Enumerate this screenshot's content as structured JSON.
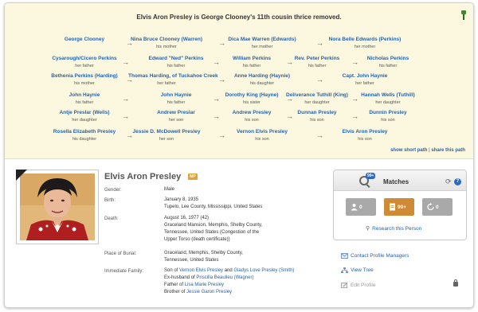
{
  "path": {
    "title": "Elvis Aron Presley is George Clooney's 11th cousin thrice removed.",
    "rows": [
      [
        {
          "name": "George Clooney",
          "rel": ""
        },
        {
          "name": "Nina Bruce Clooney (Warren)",
          "rel": "his mother"
        },
        {
          "name": "Dica Mae Warren (Edwards)",
          "rel": "her mother"
        },
        {
          "name": "Nora Belle Edwards (Perkins)",
          "rel": "her mother"
        }
      ],
      [
        {
          "name": "Cysarough/Cicero Perkins",
          "rel": "her father"
        },
        {
          "name": "Edward \"Ned\" Perkins",
          "rel": "his father"
        },
        {
          "name": "William Perkins",
          "rel": "his father"
        },
        {
          "name": "Rev. Peter Perkins",
          "rel": "his father"
        },
        {
          "name": "Nicholas Perkins",
          "rel": "his father"
        }
      ],
      [
        {
          "name": "Bethenia Perkins (Harding)",
          "rel": "his mother"
        },
        {
          "name": "Thomas Harding, of Tuckahoe Creek",
          "rel": "her father"
        },
        {
          "name": "Anne Harding (Haynie)",
          "rel": "his daughter"
        },
        {
          "name": "Capt. John Haynie",
          "rel": "her father"
        }
      ],
      [
        {
          "name": "John Haynie",
          "rel": "his father"
        },
        {
          "name": "John Haynie",
          "rel": "his father"
        },
        {
          "name": "Dorothy King (Hayne)",
          "rel": "his sister"
        },
        {
          "name": "Deliverance Tuthill (King)",
          "rel": "her daughter"
        },
        {
          "name": "Hannah Wells (Tuthill)",
          "rel": "her daughter"
        }
      ],
      [
        {
          "name": "Antje Preslar (Wells)",
          "rel": "her daughter"
        },
        {
          "name": "Andrew Preslar",
          "rel": "her son"
        },
        {
          "name": "Andrew Presley",
          "rel": "his son"
        },
        {
          "name": "Dunnan Presley",
          "rel": "his son"
        },
        {
          "name": "Dunnin Presley",
          "rel": "his son"
        }
      ],
      [
        {
          "name": "Rosella Elizabeth Presley",
          "rel": "his daughter"
        },
        {
          "name": "Jessie D. McDowell Presley",
          "rel": "her son"
        },
        {
          "name": "Vernon Elvis Presley",
          "rel": "his son"
        },
        {
          "name": "Elvis Aron Presley",
          "rel": "his son"
        }
      ]
    ],
    "show_short_path": "show short path",
    "separator": "|",
    "share_path": "share this path"
  },
  "profile": {
    "name": "Elvis Aron Presley",
    "badge": "MP",
    "facts": {
      "gender_label": "Gender:",
      "gender_value": "Male",
      "birth_label": "Birth:",
      "birth_date": "January 8, 1935",
      "birth_place": "Tupelo, Lee County, Mississippi, United States",
      "death_label": "Death:",
      "death_date": "August 16, 1977 (42)",
      "death_place_1": "Graceland Mansion, Memphis, Shelby County,",
      "death_place_2": "Tennessee, United States (Congestion of the",
      "death_place_3": "Upper Torso (death certificate))",
      "burial_label": "Place of Burial:",
      "burial_1": "Graceland, Memphis, Shelby County,",
      "burial_2": "Tennessee, United States",
      "family_label": "Immediate Family:",
      "son_of_prefix": "Son of ",
      "father": "Vernon Elvis Presley",
      "and": " and ",
      "mother": "Gladys Love Presley (Smith)",
      "ex_prefix": "Ex-husband of ",
      "ex_wife": "Priscilla Beaulieu (Wagner)",
      "father_of_prefix": "Father of ",
      "daughter": "Lisa Marie Presley",
      "brother_prefix": "Brother of ",
      "brother": "Jessie Garon Presley"
    }
  },
  "matches": {
    "title": "Matches",
    "count_badge": "99+",
    "btn_people": "0",
    "btn_records": "99+",
    "btn_sync": "0",
    "research": "Research this Person"
  },
  "actions": {
    "contact": "Contact Profile Managers",
    "view_tree": "View Tree",
    "edit_profile": "Edit Profile"
  },
  "colors": {
    "link": "#2a62a8",
    "panel": "#fbf8df",
    "accent_orange": "#cf8a35"
  }
}
